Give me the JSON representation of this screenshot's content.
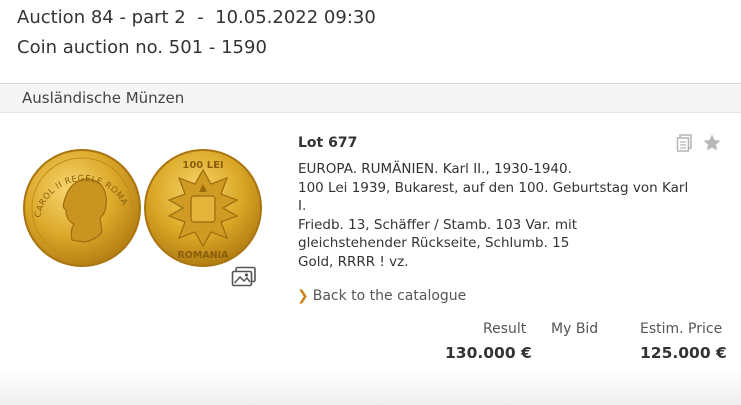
{
  "header": {
    "auction_line": "Auction 84 - part 2  -  10.05.2022 09:30",
    "coin_range_line": "Coin auction no. 501 - 1590"
  },
  "category": {
    "title": "Ausländische Münzen"
  },
  "lot": {
    "title": "Lot 677",
    "description_lines": [
      "EUROPA. RUMÄNIEN. Karl II., 1930-1940.",
      "100 Lei 1939, Bukarest, auf den 100. Geburtstag von Karl",
      "I.",
      "Friedb. 13, Schäffer / Stamb. 103 Var. mit",
      "gleichstehender Rückseite, Schlumb. 15",
      "Gold, RRRR ! vz."
    ],
    "coin_obverse_text": "CAROL II REGELE ROMANILOR",
    "coin_reverse_text": "ROMANIA",
    "coin_reverse_top": "100 LEI"
  },
  "icons": {
    "gallery": "image-gallery-icon",
    "copy": "copy-icon",
    "favorite": "star-icon",
    "back": "chevron-right-icon"
  },
  "nav": {
    "back_label": "Back to the catalogue"
  },
  "prices": {
    "result_label": "Result",
    "mybid_label": "My Bid",
    "estim_label": "Estim. Price",
    "result_value": "130.000 €",
    "estim_value": "125.000 €"
  },
  "colors": {
    "accent": "#c8861d",
    "gold": "#d9a520"
  }
}
